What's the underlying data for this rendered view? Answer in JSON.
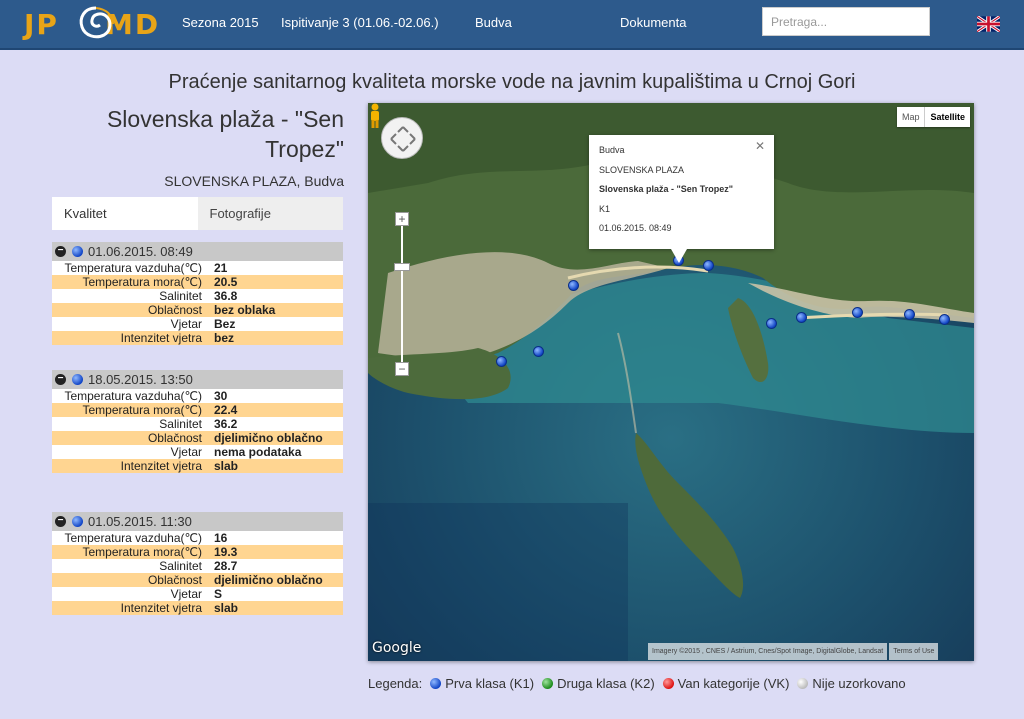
{
  "header": {
    "logo_left": "JP",
    "logo_right": "MD",
    "nav": [
      {
        "label": "Sezona 2015"
      },
      {
        "label": "Ispitivanje 3 (01.06.-02.06.)"
      },
      {
        "label": "Budva"
      },
      {
        "label": "Dokumenta"
      }
    ],
    "search_placeholder": "Pretraga...",
    "language_flag": "uk-flag-icon"
  },
  "page_title": "Praćenje sanitarnog kvaliteta morske vode na javnim kupalištima u Crnoj Gori",
  "beach": {
    "title": "Slovenska plaža - \"Sen Tropez\"",
    "subtitle": "SLOVENSKA PLAZA, Budva"
  },
  "tabs": [
    {
      "label": "Kvalitet",
      "active": true
    },
    {
      "label": "Fotografije",
      "active": false
    }
  ],
  "samples": [
    {
      "datetime": "01.06.2015. 08:49",
      "class_color": "blue",
      "rows": [
        {
          "label": "Temperatura vazduha(℃)",
          "value": "21"
        },
        {
          "label": "Temperatura mora(℃)",
          "value": "20.5"
        },
        {
          "label": "Salinitet",
          "value": "36.8"
        },
        {
          "label": "Oblačnost",
          "value": "bez oblaka"
        },
        {
          "label": "Vjetar",
          "value": "Bez"
        },
        {
          "label": "Intenzitet vjetra",
          "value": "bez"
        }
      ]
    },
    {
      "datetime": "18.05.2015. 13:50",
      "class_color": "blue",
      "rows": [
        {
          "label": "Temperatura vazduha(℃)",
          "value": "30"
        },
        {
          "label": "Temperatura mora(℃)",
          "value": "22.4"
        },
        {
          "label": "Salinitet",
          "value": "36.2"
        },
        {
          "label": "Oblačnost",
          "value": "djelimično oblačno"
        },
        {
          "label": "Vjetar",
          "value": "nema podataka"
        },
        {
          "label": "Intenzitet vjetra",
          "value": "slab"
        }
      ]
    },
    {
      "datetime": "01.05.2015. 11:30",
      "class_color": "blue",
      "rows": [
        {
          "label": "Temperatura vazduha(℃)",
          "value": "16"
        },
        {
          "label": "Temperatura mora(℃)",
          "value": "19.3"
        },
        {
          "label": "Salinitet",
          "value": "28.7"
        },
        {
          "label": "Oblačnost",
          "value": "djelimično oblačno"
        },
        {
          "label": "Vjetar",
          "value": "S"
        },
        {
          "label": "Intenzitet vjetra",
          "value": "slab"
        }
      ]
    }
  ],
  "map": {
    "type_map": "Map",
    "type_satellite": "Satellite",
    "popup": {
      "line1": "Budva",
      "line2": "SLOVENSKA PLAZA",
      "line3": "Slovenska plaža - \"Sen Tropez\"",
      "line4": "K1",
      "line5": "01.06.2015. 08:49"
    },
    "google_logo": "Google",
    "attribution": "Imagery ©2015 , CNES / Astrium, Cnes/Spot Image, DigitalGlobe, Landsat",
    "terms": "Terms of Use"
  },
  "legend": {
    "label": "Legenda:",
    "items": [
      {
        "label": "Prva klasa (K1)",
        "color": "blue"
      },
      {
        "label": "Druga klasa (K2)",
        "color": "green"
      },
      {
        "label": "Van kategorije (VK)",
        "color": "red"
      },
      {
        "label": "Nije uzorkovano",
        "color": "white"
      }
    ]
  }
}
